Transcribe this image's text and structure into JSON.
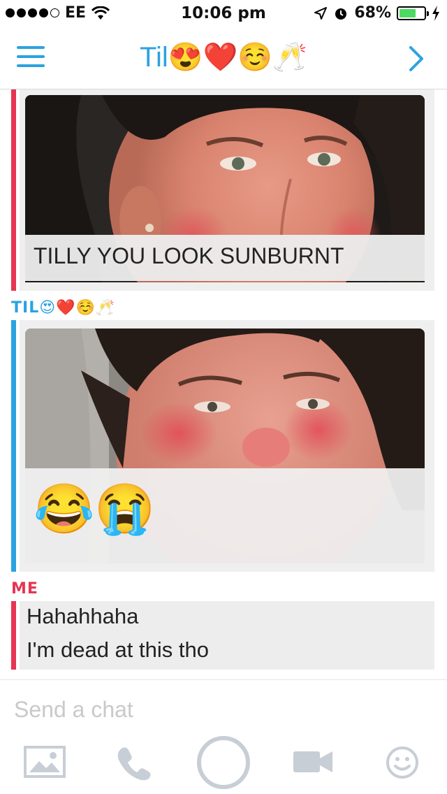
{
  "status_bar": {
    "carrier": "EE",
    "time": "10:06 pm",
    "battery_percent": "68%",
    "battery_level": 0.68,
    "icons": [
      "signal-dots-icon",
      "wifi-icon",
      "location-arrow-icon",
      "alarm-icon",
      "battery-icon",
      "charging-bolt-icon"
    ]
  },
  "header": {
    "title": "Til😍❤️☺️🥂",
    "left_icon": "menu-icon",
    "right_icon": "chevron-right-icon",
    "accent_color": "#2ba3e0"
  },
  "messages": [
    {
      "type": "snap",
      "bar_color": "#e63552",
      "caption": "TILLY YOU LOOK SUNBURNT"
    },
    {
      "type": "snap",
      "sender": "TIL😍❤️☺️🥂",
      "bar_color": "#2ba3e0",
      "caption": "😂😭"
    },
    {
      "type": "text",
      "sender": "ME",
      "bar_color": "#e63552",
      "lines": [
        "Hahahhaha",
        "I'm dead at this tho"
      ]
    }
  ],
  "composer": {
    "placeholder": "Send a chat",
    "tools": [
      "image-icon",
      "phone-icon",
      "capture-button",
      "video-icon",
      "smiley-icon"
    ]
  }
}
